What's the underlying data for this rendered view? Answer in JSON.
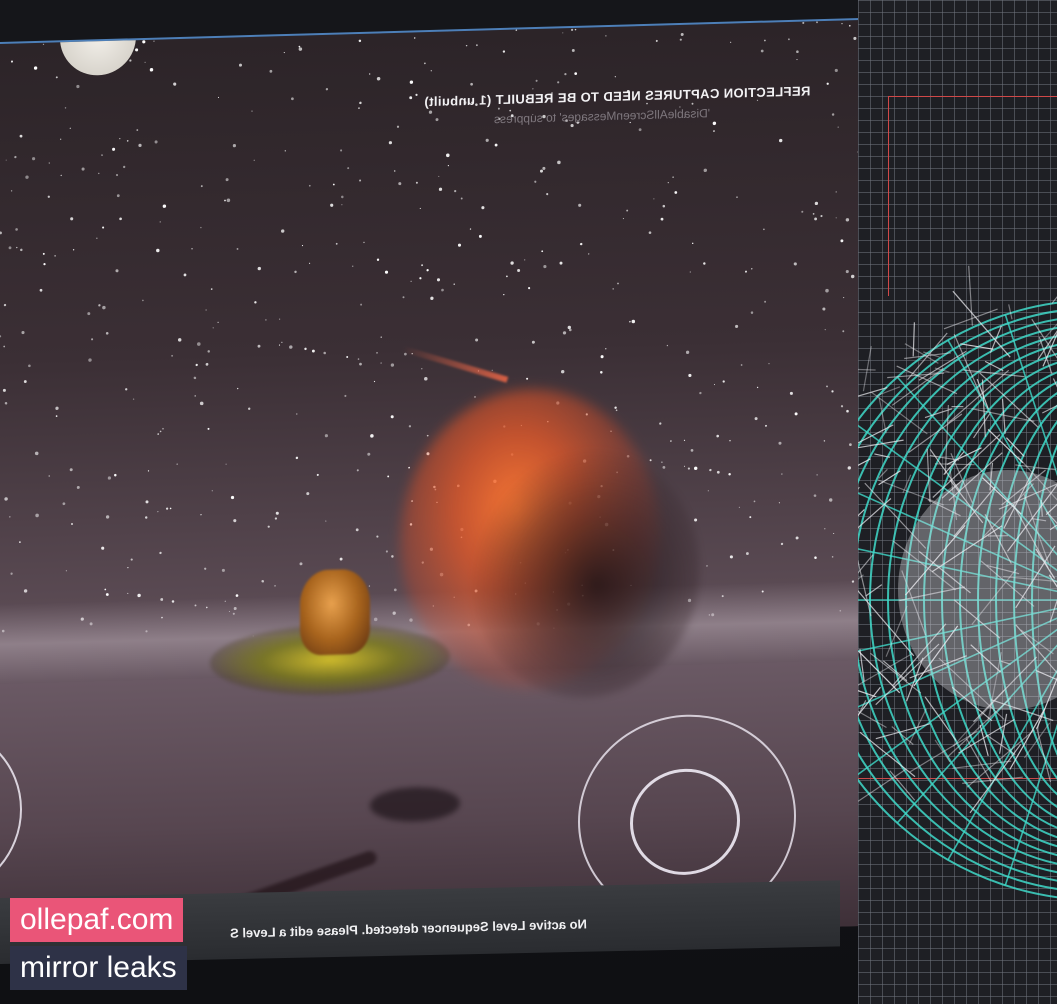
{
  "viewport": {
    "hud_warning": "REFLECTION CAPTURES NEED TO BE REBUILT (1 unbuilt)",
    "hud_subwarning": "'DisableAllScreenMessages' to suppress",
    "status_message": "No active Level Sequencer detected. Please edit a Level S",
    "controls": {
      "left_joystick_icon": "virtual-joystick-icon",
      "right_joystick_icon": "virtual-joystick-icon"
    }
  },
  "editor": {
    "grid_icon": "wireframe-sphere-icon",
    "colors": {
      "wire_primary": "#3fd9c9",
      "wire_secondary": "#e8e8ec",
      "guide_line": "#d04848"
    }
  },
  "watermark": {
    "line1": "ollepaf.com",
    "line2": "mirror leaks",
    "colors": {
      "line1_bg": "#ea5578",
      "line2_bg": "#2e3247"
    }
  }
}
